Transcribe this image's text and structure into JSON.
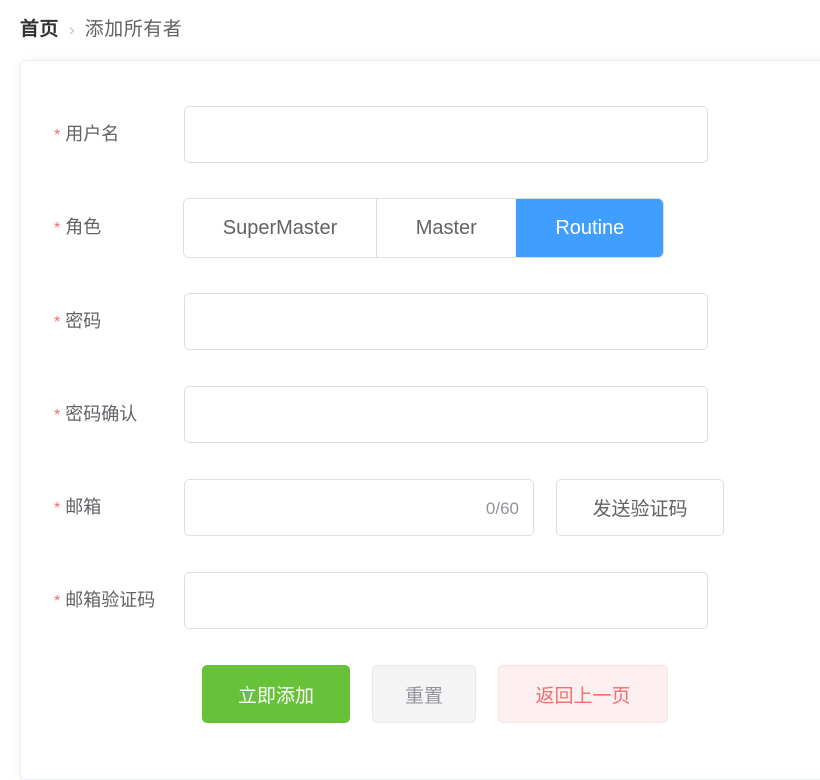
{
  "breadcrumb": {
    "home": "首页",
    "separator": "›",
    "current": "添加所有者"
  },
  "colors": {
    "primary": "#409eff",
    "success": "#67c23a",
    "danger": "#f56c6c",
    "danger_bg": "#fef0f0",
    "info_bg": "#f4f4f5",
    "border": "#dcdfe6",
    "label_text": "#606266"
  },
  "form": {
    "fields": {
      "username": {
        "label": "用户名",
        "required_mark": "*",
        "value": "",
        "placeholder": ""
      },
      "role": {
        "label": "角色",
        "required_mark": "*",
        "options": [
          "SuperMaster",
          "Master",
          "Routine"
        ],
        "selected": "Routine"
      },
      "password": {
        "label": "密码",
        "required_mark": "*",
        "value": "",
        "placeholder": ""
      },
      "password_confirm": {
        "label": "密码确认",
        "required_mark": "*",
        "value": "",
        "placeholder": ""
      },
      "email": {
        "label": "邮箱",
        "required_mark": "*",
        "value": "",
        "placeholder": "",
        "char_counter": "0/60",
        "max_length": 60,
        "send_code_label": "发送验证码"
      },
      "email_code": {
        "label": "邮箱验证码",
        "required_mark": "*",
        "value": "",
        "placeholder": ""
      }
    },
    "actions": {
      "submit": "立即添加",
      "reset": "重置",
      "back": "返回上一页"
    }
  }
}
